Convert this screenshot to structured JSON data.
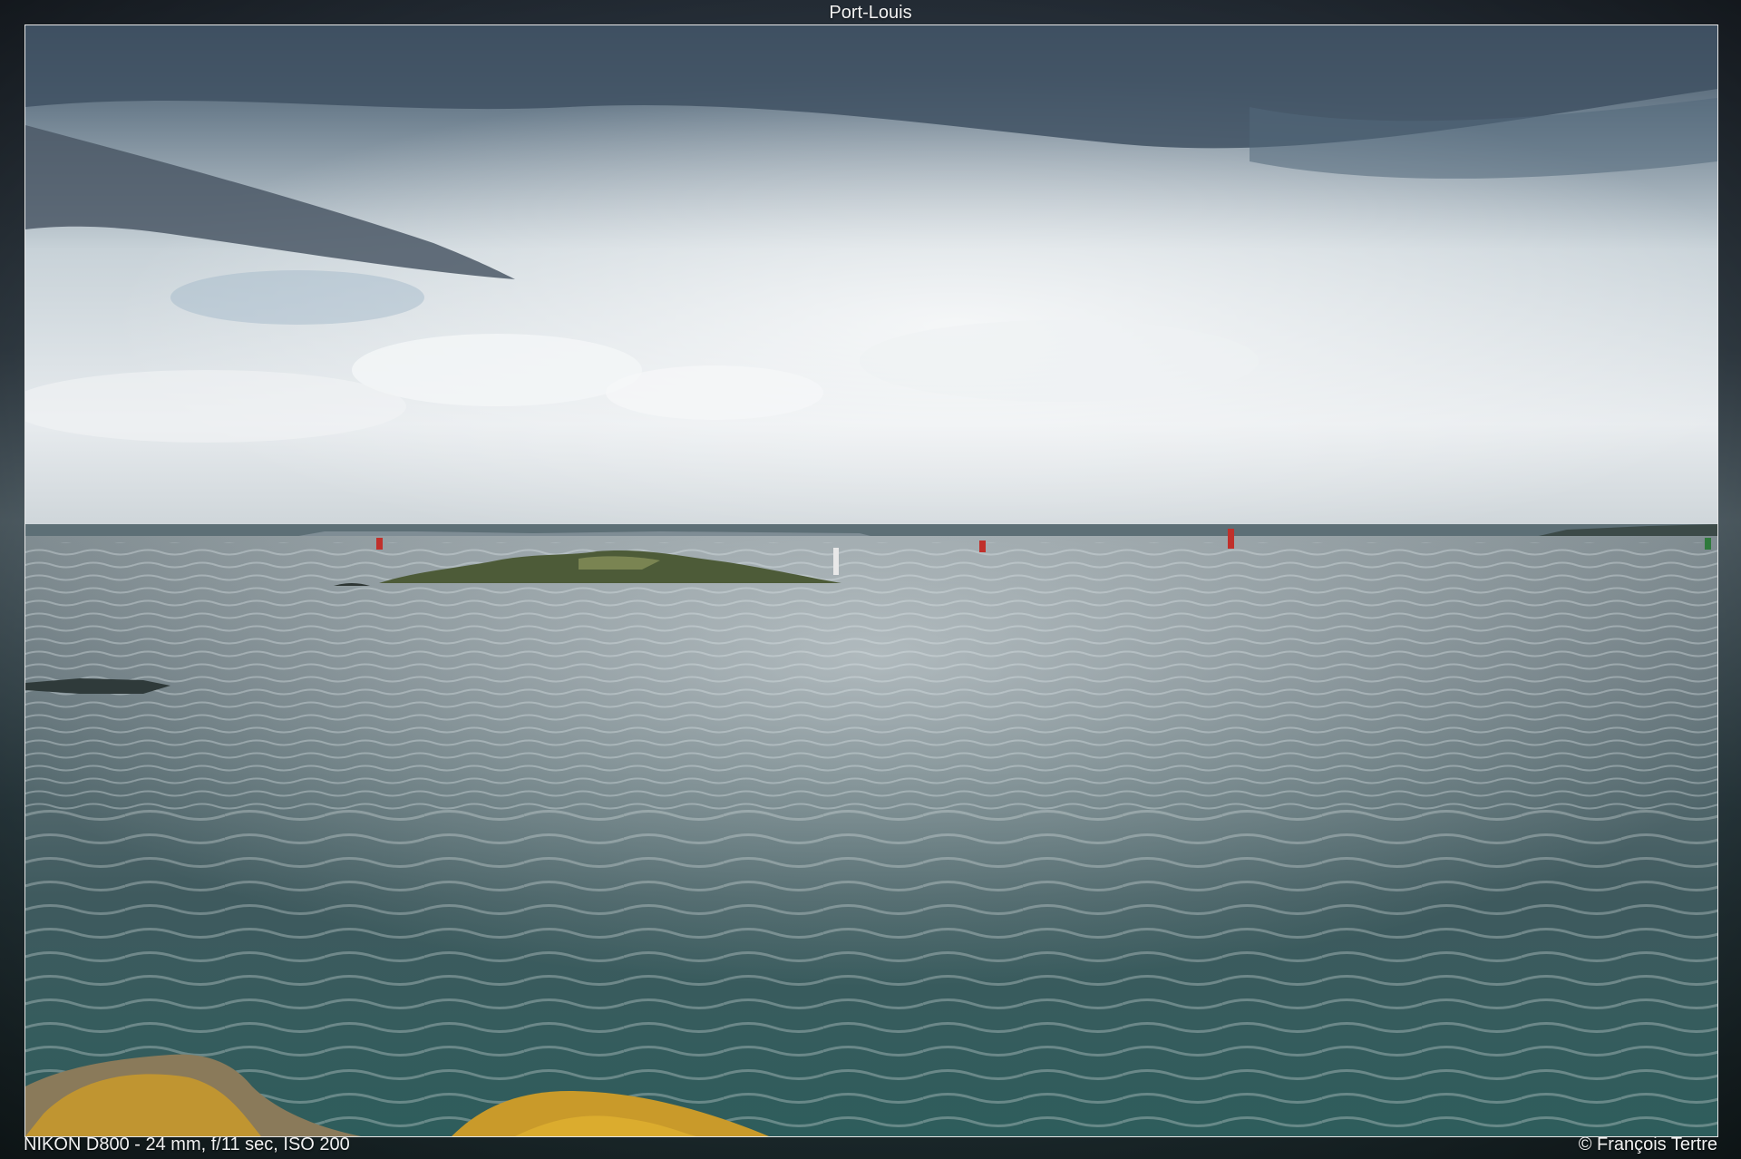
{
  "page": {
    "title": "Port-Louis",
    "camera_info": "NIKON D800 - 24 mm, f/11 sec, ISO 200",
    "credit": "© François Tertre"
  },
  "photo": {
    "subject": "sea-view-with-small-island-and-buoys",
    "colors": {
      "sky_top": "#3e4d5c",
      "sky_bright": "#e6ebee",
      "sea_far": "#6f7d84",
      "sea_near": "#2f5a5c",
      "island": "#4a5a35",
      "buoy": "#c0302b",
      "lichen": "#c99a2a"
    }
  }
}
